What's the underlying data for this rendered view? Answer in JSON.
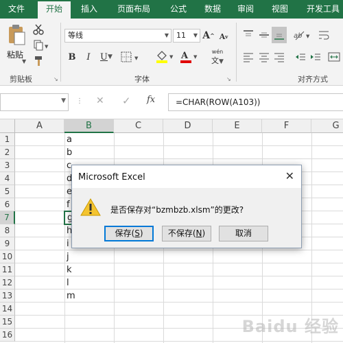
{
  "menu": {
    "tabs": [
      "文件",
      "开始",
      "插入",
      "页面布局",
      "公式",
      "数据",
      "审阅",
      "视图",
      "开发工具"
    ],
    "active_tab": "开始"
  },
  "ribbon": {
    "clipboard": {
      "paste_label": "粘贴",
      "group_label": "剪贴板"
    },
    "font": {
      "font_name": "等线",
      "font_size": "11",
      "group_label": "字体",
      "phonetic_label": "wén"
    },
    "alignment": {
      "group_label": "对齐方式"
    }
  },
  "formula_bar": {
    "name_box": "",
    "formula": "=CHAR(ROW(A103))",
    "fx_label": "fx"
  },
  "grid": {
    "columns": [
      "A",
      "B",
      "C",
      "D",
      "E",
      "F",
      "G"
    ],
    "selected_column": "B",
    "rows": [
      "1",
      "2",
      "3",
      "4",
      "5",
      "6",
      "7",
      "8",
      "9",
      "10",
      "11",
      "12",
      "13",
      "14",
      "15",
      "16"
    ],
    "selected_row": "7",
    "column_b_values": [
      "a",
      "b",
      "c",
      "d",
      "e",
      "f",
      "g",
      "h",
      "i",
      "j",
      "k",
      "l",
      "m"
    ]
  },
  "dialog": {
    "title": "Microsoft Excel",
    "message": "是否保存对“bzmbzb.xlsm”的更改?",
    "buttons": {
      "save": {
        "label": "保存(",
        "key": "S",
        "end": ")"
      },
      "dont_save": {
        "label": "不保存(",
        "key": "N",
        "end": ")"
      },
      "cancel": "取消"
    }
  },
  "watermark": "Baidu 经验",
  "colors": {
    "excel_green": "#217346",
    "ribbon_bg": "#f3f3f3",
    "dialog_accent": "#0078d7",
    "warning_yellow": "#f4c430"
  }
}
